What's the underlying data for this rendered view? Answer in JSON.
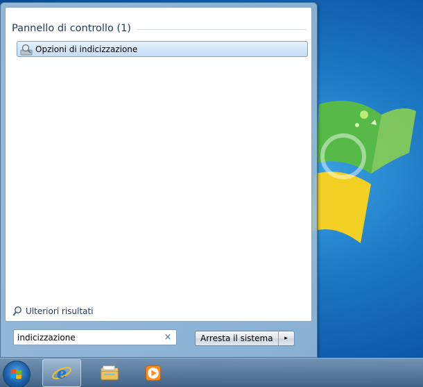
{
  "start_menu": {
    "group_header": "Pannello di controllo (1)",
    "results": [
      {
        "label": "Opzioni di indicizzazione",
        "icon": "indexing-options-icon"
      }
    ],
    "more_results_label": "Ulteriori risultati",
    "search": {
      "value": "indicizzazione",
      "clear_glyph": "×"
    },
    "shutdown": {
      "label": "Arresta il sistema",
      "arrow_glyph": "▸"
    }
  },
  "taskbar": {
    "items": [
      {
        "name": "start-orb",
        "icon": "windows-logo-icon"
      },
      {
        "name": "internet-explorer",
        "icon": "internet-explorer-icon"
      },
      {
        "name": "windows-explorer",
        "icon": "folder-icon"
      },
      {
        "name": "media-player",
        "icon": "media-player-icon"
      }
    ]
  },
  "colors": {
    "accent": "#1e395b",
    "selection": "#c4ddf5",
    "desktop": "#1c78c4"
  }
}
